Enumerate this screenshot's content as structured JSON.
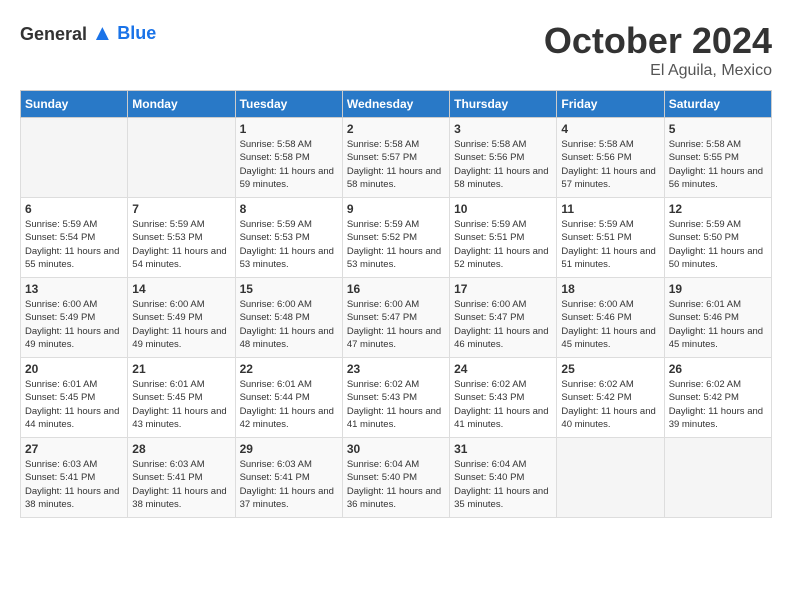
{
  "header": {
    "logo_general": "General",
    "logo_blue": "Blue",
    "title": "October 2024",
    "subtitle": "El Aguila, Mexico"
  },
  "weekdays": [
    "Sunday",
    "Monday",
    "Tuesday",
    "Wednesday",
    "Thursday",
    "Friday",
    "Saturday"
  ],
  "weeks": [
    [
      {
        "day": "",
        "sunrise": "",
        "sunset": "",
        "daylight": ""
      },
      {
        "day": "",
        "sunrise": "",
        "sunset": "",
        "daylight": ""
      },
      {
        "day": "1",
        "sunrise": "Sunrise: 5:58 AM",
        "sunset": "Sunset: 5:58 PM",
        "daylight": "Daylight: 11 hours and 59 minutes."
      },
      {
        "day": "2",
        "sunrise": "Sunrise: 5:58 AM",
        "sunset": "Sunset: 5:57 PM",
        "daylight": "Daylight: 11 hours and 58 minutes."
      },
      {
        "day": "3",
        "sunrise": "Sunrise: 5:58 AM",
        "sunset": "Sunset: 5:56 PM",
        "daylight": "Daylight: 11 hours and 58 minutes."
      },
      {
        "day": "4",
        "sunrise": "Sunrise: 5:58 AM",
        "sunset": "Sunset: 5:56 PM",
        "daylight": "Daylight: 11 hours and 57 minutes."
      },
      {
        "day": "5",
        "sunrise": "Sunrise: 5:58 AM",
        "sunset": "Sunset: 5:55 PM",
        "daylight": "Daylight: 11 hours and 56 minutes."
      }
    ],
    [
      {
        "day": "6",
        "sunrise": "Sunrise: 5:59 AM",
        "sunset": "Sunset: 5:54 PM",
        "daylight": "Daylight: 11 hours and 55 minutes."
      },
      {
        "day": "7",
        "sunrise": "Sunrise: 5:59 AM",
        "sunset": "Sunset: 5:53 PM",
        "daylight": "Daylight: 11 hours and 54 minutes."
      },
      {
        "day": "8",
        "sunrise": "Sunrise: 5:59 AM",
        "sunset": "Sunset: 5:53 PM",
        "daylight": "Daylight: 11 hours and 53 minutes."
      },
      {
        "day": "9",
        "sunrise": "Sunrise: 5:59 AM",
        "sunset": "Sunset: 5:52 PM",
        "daylight": "Daylight: 11 hours and 53 minutes."
      },
      {
        "day": "10",
        "sunrise": "Sunrise: 5:59 AM",
        "sunset": "Sunset: 5:51 PM",
        "daylight": "Daylight: 11 hours and 52 minutes."
      },
      {
        "day": "11",
        "sunrise": "Sunrise: 5:59 AM",
        "sunset": "Sunset: 5:51 PM",
        "daylight": "Daylight: 11 hours and 51 minutes."
      },
      {
        "day": "12",
        "sunrise": "Sunrise: 5:59 AM",
        "sunset": "Sunset: 5:50 PM",
        "daylight": "Daylight: 11 hours and 50 minutes."
      }
    ],
    [
      {
        "day": "13",
        "sunrise": "Sunrise: 6:00 AM",
        "sunset": "Sunset: 5:49 PM",
        "daylight": "Daylight: 11 hours and 49 minutes."
      },
      {
        "day": "14",
        "sunrise": "Sunrise: 6:00 AM",
        "sunset": "Sunset: 5:49 PM",
        "daylight": "Daylight: 11 hours and 49 minutes."
      },
      {
        "day": "15",
        "sunrise": "Sunrise: 6:00 AM",
        "sunset": "Sunset: 5:48 PM",
        "daylight": "Daylight: 11 hours and 48 minutes."
      },
      {
        "day": "16",
        "sunrise": "Sunrise: 6:00 AM",
        "sunset": "Sunset: 5:47 PM",
        "daylight": "Daylight: 11 hours and 47 minutes."
      },
      {
        "day": "17",
        "sunrise": "Sunrise: 6:00 AM",
        "sunset": "Sunset: 5:47 PM",
        "daylight": "Daylight: 11 hours and 46 minutes."
      },
      {
        "day": "18",
        "sunrise": "Sunrise: 6:00 AM",
        "sunset": "Sunset: 5:46 PM",
        "daylight": "Daylight: 11 hours and 45 minutes."
      },
      {
        "day": "19",
        "sunrise": "Sunrise: 6:01 AM",
        "sunset": "Sunset: 5:46 PM",
        "daylight": "Daylight: 11 hours and 45 minutes."
      }
    ],
    [
      {
        "day": "20",
        "sunrise": "Sunrise: 6:01 AM",
        "sunset": "Sunset: 5:45 PM",
        "daylight": "Daylight: 11 hours and 44 minutes."
      },
      {
        "day": "21",
        "sunrise": "Sunrise: 6:01 AM",
        "sunset": "Sunset: 5:45 PM",
        "daylight": "Daylight: 11 hours and 43 minutes."
      },
      {
        "day": "22",
        "sunrise": "Sunrise: 6:01 AM",
        "sunset": "Sunset: 5:44 PM",
        "daylight": "Daylight: 11 hours and 42 minutes."
      },
      {
        "day": "23",
        "sunrise": "Sunrise: 6:02 AM",
        "sunset": "Sunset: 5:43 PM",
        "daylight": "Daylight: 11 hours and 41 minutes."
      },
      {
        "day": "24",
        "sunrise": "Sunrise: 6:02 AM",
        "sunset": "Sunset: 5:43 PM",
        "daylight": "Daylight: 11 hours and 41 minutes."
      },
      {
        "day": "25",
        "sunrise": "Sunrise: 6:02 AM",
        "sunset": "Sunset: 5:42 PM",
        "daylight": "Daylight: 11 hours and 40 minutes."
      },
      {
        "day": "26",
        "sunrise": "Sunrise: 6:02 AM",
        "sunset": "Sunset: 5:42 PM",
        "daylight": "Daylight: 11 hours and 39 minutes."
      }
    ],
    [
      {
        "day": "27",
        "sunrise": "Sunrise: 6:03 AM",
        "sunset": "Sunset: 5:41 PM",
        "daylight": "Daylight: 11 hours and 38 minutes."
      },
      {
        "day": "28",
        "sunrise": "Sunrise: 6:03 AM",
        "sunset": "Sunset: 5:41 PM",
        "daylight": "Daylight: 11 hours and 38 minutes."
      },
      {
        "day": "29",
        "sunrise": "Sunrise: 6:03 AM",
        "sunset": "Sunset: 5:41 PM",
        "daylight": "Daylight: 11 hours and 37 minutes."
      },
      {
        "day": "30",
        "sunrise": "Sunrise: 6:04 AM",
        "sunset": "Sunset: 5:40 PM",
        "daylight": "Daylight: 11 hours and 36 minutes."
      },
      {
        "day": "31",
        "sunrise": "Sunrise: 6:04 AM",
        "sunset": "Sunset: 5:40 PM",
        "daylight": "Daylight: 11 hours and 35 minutes."
      },
      {
        "day": "",
        "sunrise": "",
        "sunset": "",
        "daylight": ""
      },
      {
        "day": "",
        "sunrise": "",
        "sunset": "",
        "daylight": ""
      }
    ]
  ]
}
